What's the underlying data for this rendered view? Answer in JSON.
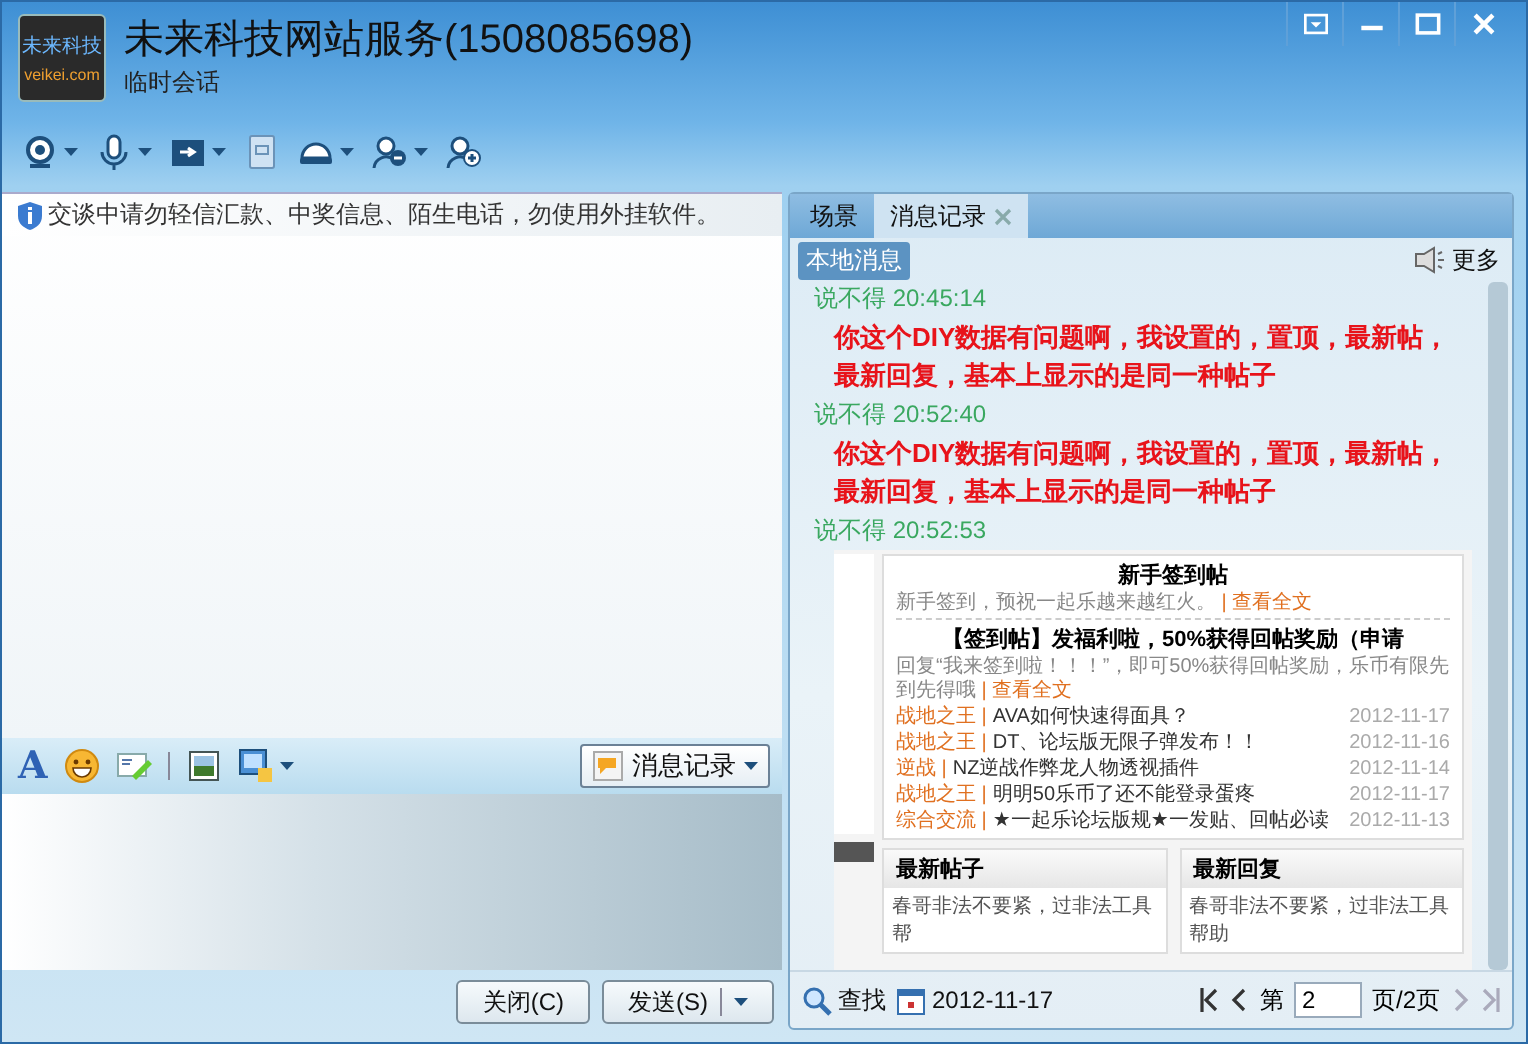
{
  "window": {
    "title": "未来科技网站服务(1508085698)",
    "subtitle": "临时会话",
    "avatar_lines": [
      "未来科技",
      "veikei.com"
    ],
    "controls": [
      {
        "kind": "skin"
      },
      {
        "kind": "minimize"
      },
      {
        "kind": "maximize"
      },
      {
        "kind": "close"
      }
    ]
  },
  "toolbar": [
    {
      "kind": "webcam",
      "has_menu": true
    },
    {
      "kind": "mic",
      "has_menu": true
    },
    {
      "kind": "file",
      "has_menu": true
    },
    {
      "kind": "tablet",
      "has_menu": false
    },
    {
      "kind": "cap",
      "has_menu": true
    },
    {
      "kind": "person-minus",
      "has_menu": true
    },
    {
      "kind": "person-plus",
      "has_menu": false
    }
  ],
  "notice": "交谈中请勿轻信汇款、中奖信息、陌生电话，勿使用外挂软件。",
  "format_toolbar": {
    "font_glyph": "A",
    "tools": [
      {
        "kind": "smiley",
        "has_menu": false
      },
      {
        "kind": "note",
        "has_menu": false
      },
      {
        "kind": "picture",
        "has_menu": false
      },
      {
        "kind": "screenshot",
        "has_menu": true
      }
    ],
    "history_button": "消息记录"
  },
  "buttons": [
    {
      "label": "关闭(C)",
      "has_menu": false
    },
    {
      "label": "发送(S)",
      "has_menu": true
    }
  ],
  "tabs": [
    {
      "label": "场景",
      "selected": false,
      "closable": false
    },
    {
      "label": "消息记录",
      "selected": true,
      "closable": true
    }
  ],
  "sub_tab": "本地消息",
  "more": "更多",
  "messages": [
    {
      "header": "说不得 20:45:14",
      "kind": "text",
      "text": "你这个DIY数据有问题啊，我设置的，置顶，最新帖，最新回复，基本上显示的是同一种帖子"
    },
    {
      "header": "说不得 20:52:40",
      "kind": "text",
      "text": "你这个DIY数据有问题啊，我设置的，置顶，最新帖，最新回复，基本上显示的是同一种帖子"
    },
    {
      "header": "说不得 20:52:53",
      "kind": "image",
      "image": {
        "title": "新手签到帖",
        "desc": "新手签到，预祝一起乐越来越红火。",
        "desc_link": "| 查看全文",
        "headline": "【签到帖】发福利啦，50%获得回帖奖励（申请",
        "desc2": "回复“我来签到啦！！！”，即可50%获得回帖奖励，乐币有限先到先得哦",
        "desc2_link": "| 查看全文",
        "rows": [
          {
            "category": "战地之王 |",
            "title": "AVA如何快速得面具？",
            "date": "2012-11-17"
          },
          {
            "category": "战地之王 |",
            "title": "DT、论坛版无限子弹发布！！",
            "date": "2012-11-16"
          },
          {
            "category": "逆战 |",
            "title": "NZ逆战作弊龙人物透视插件",
            "date": "2012-11-14"
          },
          {
            "category": "战地之王 |",
            "title": "明明50乐币了还不能登录蛋疼",
            "date": "2012-11-17"
          },
          {
            "category": "综合交流 |",
            "title": "★一起乐论坛版规★一发贴、回帖必读",
            "date": "2012-11-13"
          }
        ],
        "panels": [
          {
            "title": "最新帖子",
            "line": "春哥非法不要紧，过非法工具帮"
          },
          {
            "title": "最新回复",
            "line": "春哥非法不要紧，过非法工具帮助"
          }
        ]
      }
    }
  ],
  "footer": {
    "search": "查找",
    "date": "2012-11-17",
    "page_prefix": "第",
    "page": "2",
    "page_suffix": "页/2页",
    "can_prev": true,
    "can_next": false
  }
}
